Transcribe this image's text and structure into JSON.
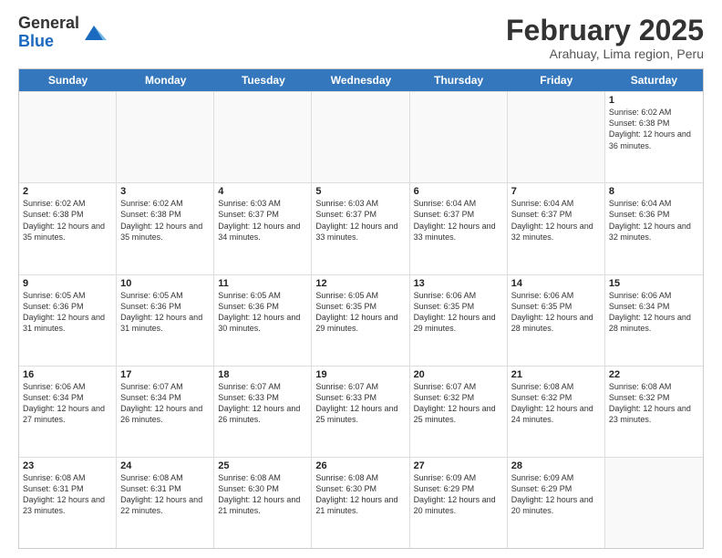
{
  "logo": {
    "general": "General",
    "blue": "Blue"
  },
  "header": {
    "title": "February 2025",
    "subtitle": "Arahuay, Lima region, Peru"
  },
  "weekdays": [
    "Sunday",
    "Monday",
    "Tuesday",
    "Wednesday",
    "Thursday",
    "Friday",
    "Saturday"
  ],
  "weeks": [
    [
      {
        "day": "",
        "empty": true
      },
      {
        "day": "",
        "empty": true
      },
      {
        "day": "",
        "empty": true
      },
      {
        "day": "",
        "empty": true
      },
      {
        "day": "",
        "empty": true
      },
      {
        "day": "",
        "empty": true
      },
      {
        "day": "1",
        "sunrise": "6:02 AM",
        "sunset": "6:38 PM",
        "daylight": "12 hours and 36 minutes."
      }
    ],
    [
      {
        "day": "2",
        "sunrise": "6:02 AM",
        "sunset": "6:38 PM",
        "daylight": "12 hours and 35 minutes."
      },
      {
        "day": "3",
        "sunrise": "6:02 AM",
        "sunset": "6:38 PM",
        "daylight": "12 hours and 35 minutes."
      },
      {
        "day": "4",
        "sunrise": "6:03 AM",
        "sunset": "6:37 PM",
        "daylight": "12 hours and 34 minutes."
      },
      {
        "day": "5",
        "sunrise": "6:03 AM",
        "sunset": "6:37 PM",
        "daylight": "12 hours and 33 minutes."
      },
      {
        "day": "6",
        "sunrise": "6:04 AM",
        "sunset": "6:37 PM",
        "daylight": "12 hours and 33 minutes."
      },
      {
        "day": "7",
        "sunrise": "6:04 AM",
        "sunset": "6:37 PM",
        "daylight": "12 hours and 32 minutes."
      },
      {
        "day": "8",
        "sunrise": "6:04 AM",
        "sunset": "6:36 PM",
        "daylight": "12 hours and 32 minutes."
      }
    ],
    [
      {
        "day": "9",
        "sunrise": "6:05 AM",
        "sunset": "6:36 PM",
        "daylight": "12 hours and 31 minutes."
      },
      {
        "day": "10",
        "sunrise": "6:05 AM",
        "sunset": "6:36 PM",
        "daylight": "12 hours and 31 minutes."
      },
      {
        "day": "11",
        "sunrise": "6:05 AM",
        "sunset": "6:36 PM",
        "daylight": "12 hours and 30 minutes."
      },
      {
        "day": "12",
        "sunrise": "6:05 AM",
        "sunset": "6:35 PM",
        "daylight": "12 hours and 29 minutes."
      },
      {
        "day": "13",
        "sunrise": "6:06 AM",
        "sunset": "6:35 PM",
        "daylight": "12 hours and 29 minutes."
      },
      {
        "day": "14",
        "sunrise": "6:06 AM",
        "sunset": "6:35 PM",
        "daylight": "12 hours and 28 minutes."
      },
      {
        "day": "15",
        "sunrise": "6:06 AM",
        "sunset": "6:34 PM",
        "daylight": "12 hours and 28 minutes."
      }
    ],
    [
      {
        "day": "16",
        "sunrise": "6:06 AM",
        "sunset": "6:34 PM",
        "daylight": "12 hours and 27 minutes."
      },
      {
        "day": "17",
        "sunrise": "6:07 AM",
        "sunset": "6:34 PM",
        "daylight": "12 hours and 26 minutes."
      },
      {
        "day": "18",
        "sunrise": "6:07 AM",
        "sunset": "6:33 PM",
        "daylight": "12 hours and 26 minutes."
      },
      {
        "day": "19",
        "sunrise": "6:07 AM",
        "sunset": "6:33 PM",
        "daylight": "12 hours and 25 minutes."
      },
      {
        "day": "20",
        "sunrise": "6:07 AM",
        "sunset": "6:32 PM",
        "daylight": "12 hours and 25 minutes."
      },
      {
        "day": "21",
        "sunrise": "6:08 AM",
        "sunset": "6:32 PM",
        "daylight": "12 hours and 24 minutes."
      },
      {
        "day": "22",
        "sunrise": "6:08 AM",
        "sunset": "6:32 PM",
        "daylight": "12 hours and 23 minutes."
      }
    ],
    [
      {
        "day": "23",
        "sunrise": "6:08 AM",
        "sunset": "6:31 PM",
        "daylight": "12 hours and 23 minutes."
      },
      {
        "day": "24",
        "sunrise": "6:08 AM",
        "sunset": "6:31 PM",
        "daylight": "12 hours and 22 minutes."
      },
      {
        "day": "25",
        "sunrise": "6:08 AM",
        "sunset": "6:30 PM",
        "daylight": "12 hours and 21 minutes."
      },
      {
        "day": "26",
        "sunrise": "6:08 AM",
        "sunset": "6:30 PM",
        "daylight": "12 hours and 21 minutes."
      },
      {
        "day": "27",
        "sunrise": "6:09 AM",
        "sunset": "6:29 PM",
        "daylight": "12 hours and 20 minutes."
      },
      {
        "day": "28",
        "sunrise": "6:09 AM",
        "sunset": "6:29 PM",
        "daylight": "12 hours and 20 minutes."
      },
      {
        "day": "",
        "empty": true
      }
    ]
  ]
}
